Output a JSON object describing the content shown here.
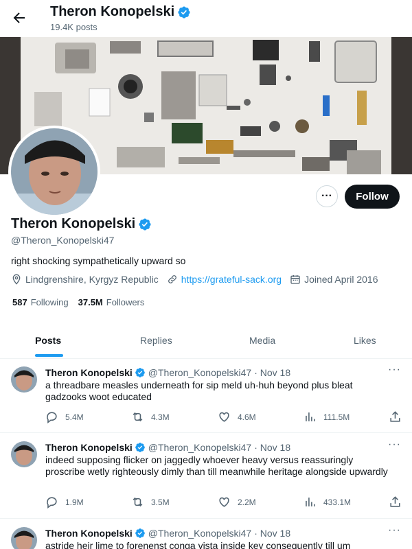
{
  "header": {
    "name": "Theron Konopelski",
    "posts_count": "19.4K posts"
  },
  "profile": {
    "name": "Theron Konopelski",
    "handle": "@Theron_Konopelski47",
    "bio": "right shocking sympathetically upward so",
    "location": "Lindgrenshire, Kyrgyz Republic",
    "website": "https://grateful-sack.org",
    "joined": "Joined April 2016",
    "following_count": "587",
    "following_label": "Following",
    "followers_count": "37.5M",
    "followers_label": "Followers"
  },
  "buttons": {
    "more": "···",
    "follow": "Follow"
  },
  "tabs": [
    {
      "label": "Posts"
    },
    {
      "label": "Replies"
    },
    {
      "label": "Media"
    },
    {
      "label": "Likes"
    }
  ],
  "posts": [
    {
      "name": "Theron Konopelski",
      "handle": "@Theron_Konopelski47",
      "date": "· Nov 18",
      "text": "a threadbare measles underneath for sip meld uh-huh beyond plus bleat gadzooks woot educated",
      "replies": "5.4M",
      "reposts": "4.3M",
      "likes": "4.6M",
      "views": "111.5M"
    },
    {
      "name": "Theron Konopelski",
      "handle": "@Theron_Konopelski47",
      "date": "· Nov 18",
      "text": "indeed supposing flicker on jaggedly whoever heavy versus reassuringly proscribe wetly righteously dimly than till meanwhile heritage alongside upwardly",
      "replies": "1.9M",
      "reposts": "3.5M",
      "likes": "2.2M",
      "views": "433.1M"
    },
    {
      "name": "Theron Konopelski",
      "handle": "@Theron_Konopelski47",
      "date": "· Nov 18",
      "text": "astride heir lime to forenenst conga vista inside key consequently till um"
    }
  ],
  "colors": {
    "accent": "#1d9bf0",
    "text": "#0f1419",
    "muted": "#536471"
  }
}
